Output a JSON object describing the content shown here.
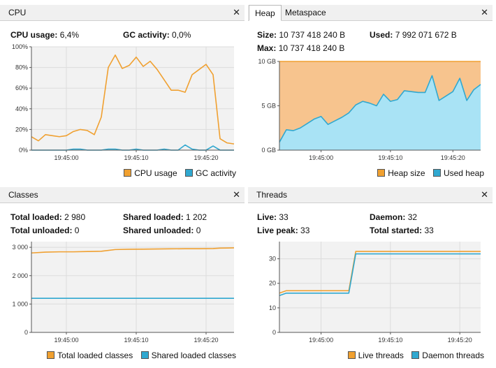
{
  "colors": {
    "orange": "#f0a030",
    "blue": "#30a8d0",
    "orange_fill": "#f7c48e",
    "blue_fill": "#a9e3f5"
  },
  "cpu": {
    "tab": "CPU",
    "close": "✕",
    "usage_label": "CPU usage:",
    "usage_value": "6,4%",
    "gc_label": "GC activity:",
    "gc_value": "0,0%",
    "legend": [
      "CPU usage",
      "GC activity"
    ]
  },
  "memory": {
    "tabs": [
      "Heap",
      "Metaspace"
    ],
    "close": "✕",
    "size_label": "Size:",
    "size_value": "10 737 418 240 B",
    "used_label": "Used:",
    "used_value": "7 992 071 672 B",
    "max_label": "Max:",
    "max_value": "10 737 418 240 B",
    "legend": [
      "Heap size",
      "Used heap"
    ]
  },
  "classes": {
    "tab": "Classes",
    "close": "✕",
    "total_loaded_label": "Total loaded:",
    "total_loaded_value": "2 980",
    "shared_loaded_label": "Shared loaded:",
    "shared_loaded_value": "1 202",
    "total_unloaded_label": "Total unloaded:",
    "total_unloaded_value": "0",
    "shared_unloaded_label": "Shared unloaded:",
    "shared_unloaded_value": "0",
    "legend": [
      "Total loaded classes",
      "Shared loaded classes"
    ]
  },
  "threads": {
    "tab": "Threads",
    "close": "✕",
    "live_label": "Live:",
    "live_value": "33",
    "daemon_label": "Daemon:",
    "daemon_value": "32",
    "peak_label": "Live peak:",
    "peak_value": "33",
    "started_label": "Total started:",
    "started_value": "33",
    "legend": [
      "Live threads",
      "Daemon threads"
    ]
  },
  "chart_data": [
    {
      "id": "cpu",
      "type": "line",
      "xlim": [
        0,
        29
      ],
      "ylim": [
        0,
        100
      ],
      "yticks": [
        0,
        20,
        40,
        60,
        80,
        100
      ],
      "ytick_labels": [
        "0%",
        "20%",
        "40%",
        "60%",
        "80%",
        "100%"
      ],
      "xticks": [
        5,
        15,
        25
      ],
      "xtick_labels": [
        "19:45:00",
        "19:45:10",
        "19:45:20"
      ],
      "series": [
        {
          "name": "CPU usage",
          "color": "orange",
          "x": [
            0,
            1,
            2,
            3,
            4,
            5,
            6,
            7,
            8,
            9,
            10,
            11,
            12,
            13,
            14,
            15,
            16,
            17,
            18,
            19,
            20,
            21,
            22,
            23,
            24,
            25,
            26,
            27,
            28,
            29
          ],
          "y": [
            13,
            9,
            15,
            14,
            13,
            14,
            18,
            20,
            19,
            15,
            32,
            80,
            92,
            79,
            82,
            90,
            81,
            86,
            78,
            68,
            58,
            58,
            56,
            73,
            78,
            83,
            73,
            11,
            7,
            6
          ]
        },
        {
          "name": "GC activity",
          "color": "blue",
          "x": [
            0,
            5,
            6,
            7,
            8,
            9,
            10,
            11,
            12,
            13,
            14,
            15,
            16,
            17,
            18,
            19,
            20,
            21,
            22,
            23,
            24,
            25,
            26,
            27,
            28,
            29
          ],
          "y": [
            0,
            0,
            1,
            1,
            0,
            0,
            0,
            1,
            1,
            0,
            0,
            1,
            0,
            0,
            0,
            1,
            0,
            0,
            5,
            1,
            0,
            0,
            4,
            0,
            0,
            0
          ]
        }
      ]
    },
    {
      "id": "heap",
      "type": "area",
      "xlim": [
        0,
        29
      ],
      "ylim": [
        0,
        10
      ],
      "yticks": [
        0,
        5,
        10
      ],
      "ytick_labels": [
        "0 GB",
        "5 GB",
        "10 GB"
      ],
      "xticks": [
        6,
        16,
        25
      ],
      "xtick_labels": [
        "19:45:00",
        "19:45:10",
        "19:45:20"
      ],
      "series": [
        {
          "name": "Heap size",
          "color": "orange",
          "x": [
            0,
            29
          ],
          "y": [
            10,
            10
          ]
        },
        {
          "name": "Used heap",
          "color": "blue",
          "x": [
            0,
            1,
            2,
            3,
            4,
            5,
            6,
            7,
            8,
            9,
            10,
            11,
            12,
            13,
            14,
            15,
            16,
            17,
            18,
            19,
            20,
            21,
            22,
            23,
            24,
            25,
            26,
            27,
            28,
            29
          ],
          "y": [
            0.9,
            2.3,
            2.2,
            2.5,
            3.0,
            3.5,
            3.8,
            2.9,
            3.3,
            3.7,
            4.2,
            5.1,
            5.5,
            5.3,
            5.0,
            6.3,
            5.5,
            5.7,
            6.7,
            6.6,
            6.5,
            6.5,
            8.4,
            5.6,
            6.1,
            6.6,
            8.1,
            5.6,
            6.8,
            7.4
          ]
        }
      ]
    },
    {
      "id": "classes",
      "type": "line",
      "xlim": [
        0,
        29
      ],
      "ylim": [
        0,
        3200
      ],
      "yticks": [
        0,
        1000,
        2000,
        3000
      ],
      "ytick_labels": [
        "0",
        "1 000",
        "2 000",
        "3 000"
      ],
      "xticks": [
        5,
        15,
        25
      ],
      "xtick_labels": [
        "19:45:00",
        "19:45:10",
        "19:45:20"
      ],
      "series": [
        {
          "name": "Total loaded classes",
          "color": "orange",
          "x": [
            0,
            2,
            4,
            6,
            8,
            10,
            12,
            14,
            16,
            18,
            20,
            22,
            24,
            26,
            27,
            28,
            29
          ],
          "y": [
            2800,
            2830,
            2840,
            2840,
            2850,
            2860,
            2920,
            2930,
            2935,
            2940,
            2945,
            2950,
            2950,
            2955,
            2970,
            2975,
            2980
          ]
        },
        {
          "name": "Shared loaded classes",
          "color": "blue",
          "x": [
            0,
            29
          ],
          "y": [
            1202,
            1202
          ]
        }
      ]
    },
    {
      "id": "threads",
      "type": "line",
      "xlim": [
        0,
        29
      ],
      "ylim": [
        0,
        37
      ],
      "yticks": [
        0,
        10,
        20,
        30
      ],
      "ytick_labels": [
        "0",
        "10",
        "20",
        "30"
      ],
      "xticks": [
        6,
        16,
        26
      ],
      "xtick_labels": [
        "19:45:00",
        "19:45:10",
        "19:45:20"
      ],
      "series": [
        {
          "name": "Live threads",
          "color": "orange",
          "x": [
            0,
            1,
            10,
            11,
            29
          ],
          "y": [
            16,
            17,
            17,
            33,
            33
          ]
        },
        {
          "name": "Daemon threads",
          "color": "blue",
          "x": [
            0,
            1,
            10,
            11,
            29
          ],
          "y": [
            15,
            16,
            16,
            32,
            32
          ]
        }
      ]
    }
  ]
}
